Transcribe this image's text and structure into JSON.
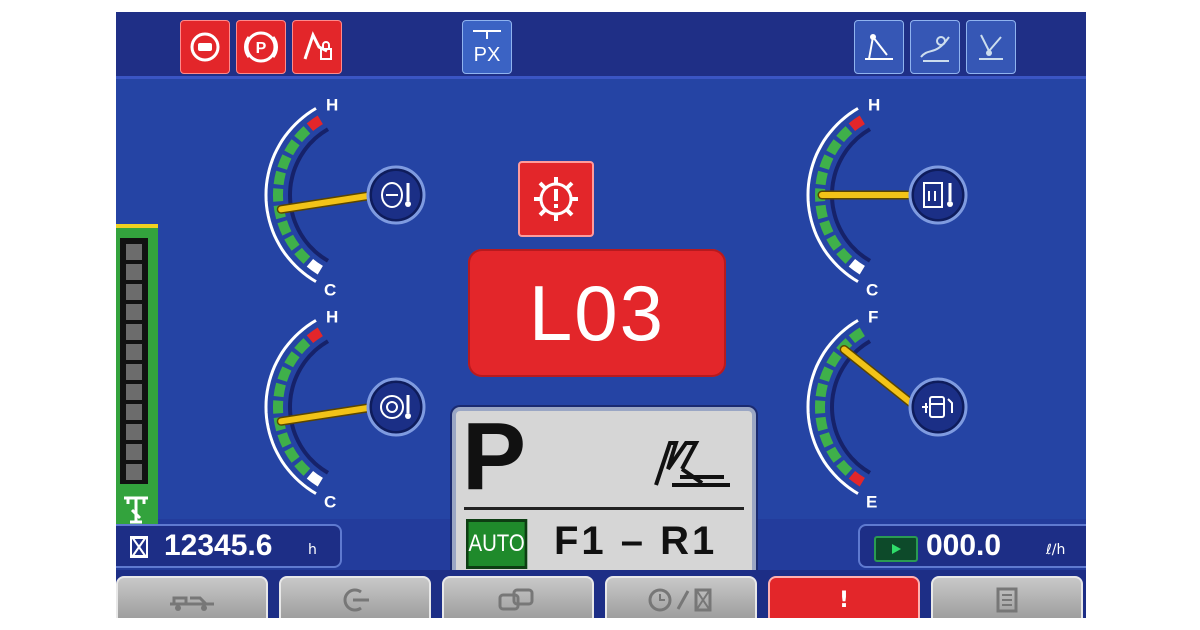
{
  "topbar": {
    "indicators_left": [
      {
        "icon": "engine-warning-icon",
        "state": "red"
      },
      {
        "icon": "parking-brake-icon",
        "label": "P",
        "state": "red"
      },
      {
        "icon": "work-equipment-lock-icon",
        "state": "red"
      }
    ],
    "indicator_center": {
      "icon": "px-mode-icon",
      "label": "PX"
    },
    "indicators_right": [
      {
        "icon": "work-mode-icon",
        "state": "blue"
      },
      {
        "icon": "economy-mode-icon",
        "state": "blue"
      },
      {
        "icon": "slip-mode-icon",
        "state": "blue"
      }
    ]
  },
  "gauges": {
    "engine_coolant_temp": {
      "top_label": "H",
      "bottom_label": "C",
      "icon": "coolant-temperature-icon",
      "level": 0.42
    },
    "torque_converter_oil_temp": {
      "top_label": "H",
      "bottom_label": "C",
      "icon": "transmission-oil-temperature-icon",
      "level": 0.42
    },
    "hydraulic_oil_temp": {
      "top_label": "H",
      "bottom_label": "C",
      "icon": "hydraulic-oil-temperature-icon",
      "level": 0.5
    },
    "fuel_level": {
      "top_label": "F",
      "bottom_label": "E",
      "icon": "fuel-icon",
      "level": 0.85
    }
  },
  "center": {
    "warning_icon": "system-warning-icon",
    "error_code": "L03",
    "gear": "P",
    "shift_mode": "AUTO",
    "shift_range": "F1 – R1",
    "bucket_icon": "dozer-blade-icon"
  },
  "sidebar": {
    "segments_total": 12,
    "icon": "ripper-icon"
  },
  "status": {
    "hour_meter": "12345.6",
    "hour_unit": "h",
    "fuel_rate": "000.0",
    "fuel_unit": "ℓ/h"
  },
  "softkeys": [
    {
      "icon": "machine-settings-icon"
    },
    {
      "icon": "back-icon"
    },
    {
      "icon": "operation-mode-icon"
    },
    {
      "icon": "clock-hour-meter-icon"
    },
    {
      "icon": "alert-icon",
      "label": "!",
      "state": "red"
    },
    {
      "icon": "menu-list-icon"
    }
  ],
  "colors": {
    "screen_bg": "#233c9c",
    "warning_red": "#e3262a",
    "gauge_green": "#3fb04a",
    "needle_yellow": "#f2c318"
  }
}
